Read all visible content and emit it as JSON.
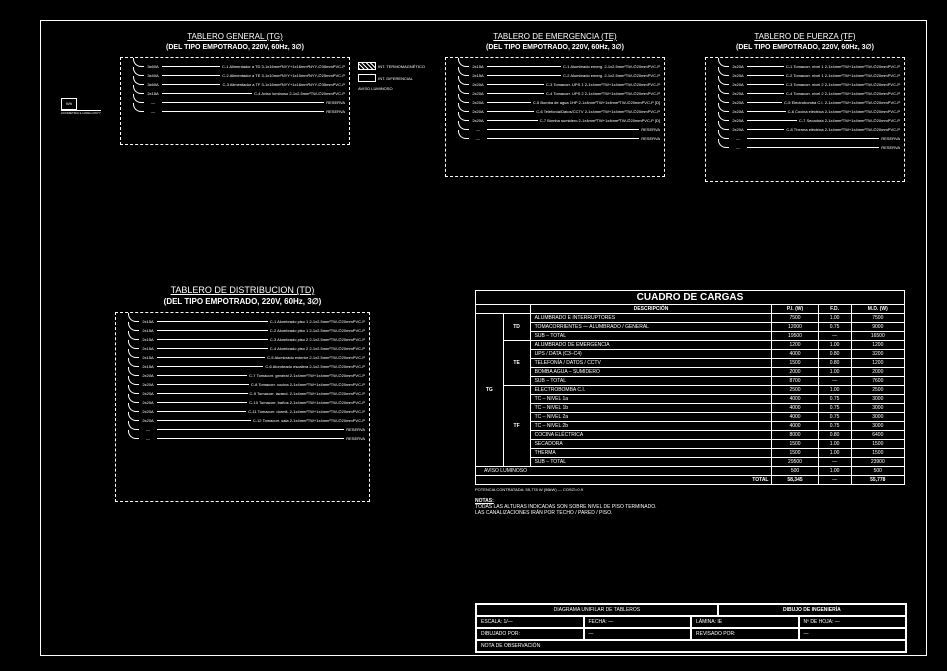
{
  "panels": {
    "tg": {
      "title": "TABLERO GENERAL (TG)",
      "sub": "(DEL TIPO EMPOTRADO, 220V, 60Hz, 3∅)",
      "circuits": [
        {
          "brk": "3x60A",
          "desc": "C-1 Alimentador a TD 3-1x16mm²NYY+1x16mm²NYY-∅35mmPVC-P"
        },
        {
          "brk": "3x40A",
          "desc": "C-2 Alimentador a TE 3-1x10mm²NYY+1x10mm²NYY-∅25mmPVC-P"
        },
        {
          "brk": "3x60A",
          "desc": "C-3 Alimentador a TF 3-1x16mm²NYY+1x16mm²NYY-∅35mmPVC-P"
        },
        {
          "brk": "2x15A",
          "desc": "C-4 Aviso luminoso 2-1x2.5mm²TW-∅20mmPVC-P"
        },
        {
          "brk": "—",
          "desc": "RESERVA"
        },
        {
          "brk": "—",
          "desc": "RESERVA"
        }
      ],
      "feed": {
        "meter": "Wh",
        "label": "ACOMETIDA  3-1x50mm²NYY"
      },
      "legend": [
        {
          "label": "INT. TERMOMAGNÉTICO",
          "cls": "hatch"
        },
        {
          "label": "INT. DIFERENCIAL",
          "cls": ""
        },
        {
          "label": "AVISO LUMINOSO",
          "cls": ""
        }
      ]
    },
    "te": {
      "title": "TABLERO DE EMERGENCIA (TE)",
      "sub": "(DEL TIPO EMPOTRADO, 220V, 60Hz, 3∅)",
      "circuits": [
        {
          "brk": "2x15A",
          "desc": "C-1 Alumbrado emerg. 2-1x2.5mm²TW-∅20mmPVC-P"
        },
        {
          "brk": "2x15A",
          "desc": "C-2 Alumbrado emerg. 2-1x2.5mm²TW-∅20mmPVC-P"
        },
        {
          "brk": "2x20A",
          "desc": "C-3 Tomacorr. UPS 1  2-1x4mm²TW+1x4mm²TW-∅20mmPVC-P"
        },
        {
          "brk": "2x20A",
          "desc": "C-4 Tomacorr. UPS 2  2-1x4mm²TW+1x4mm²TW-∅20mmPVC-P"
        },
        {
          "brk": "2x20A",
          "desc": "C-5 Bomba de agua 1HP 2-1x4mm²TW+1x4mm²TW-∅20mmPVC-P [D]"
        },
        {
          "brk": "2x20A",
          "desc": "C-6 Telefonía/Datos/CCTV 2-1x4mm²TW+1x4mm²TW-∅20mmPVC-P"
        },
        {
          "brk": "2x20A",
          "desc": "C-7 Bomba sumidero 2-1x4mm²TW+1x4mm²TW-∅20mmPVC-P [D]"
        },
        {
          "brk": "—",
          "desc": "RESERVA"
        },
        {
          "brk": "—",
          "desc": "RESERVA"
        }
      ]
    },
    "tf": {
      "title": "TABLERO DE FUERZA (TF)",
      "sub": "(DEL TIPO EMPOTRADO, 220V, 60Hz, 3∅)",
      "circuits": [
        {
          "brk": "2x20A",
          "desc": "C-1 Tomacorr. nivel 1  2-1x4mm²TW+1x4mm²TW-∅20mmPVC-P"
        },
        {
          "brk": "2x20A",
          "desc": "C-2 Tomacorr. nivel 1  2-1x4mm²TW+1x4mm²TW-∅20mmPVC-P"
        },
        {
          "brk": "2x20A",
          "desc": "C-3 Tomacorr. nivel 2  2-1x4mm²TW+1x4mm²TW-∅20mmPVC-P"
        },
        {
          "brk": "2x20A",
          "desc": "C-4 Tomacorr. nivel 2  2-1x4mm²TW+1x4mm²TW-∅20mmPVC-P"
        },
        {
          "brk": "2x20A",
          "desc": "C-5 Electrobomba C.I.  2-1x4mm²TW+1x4mm²TW-∅20mmPVC-P"
        },
        {
          "brk": "2x20A",
          "desc": "C-6 Cocina eléctrica   2-1x4mm²TW+1x4mm²TW-∅20mmPVC-P"
        },
        {
          "brk": "2x20A",
          "desc": "C-7 Secadora           2-1x4mm²TW+1x4mm²TW-∅20mmPVC-P"
        },
        {
          "brk": "2x20A",
          "desc": "C-8 Therma eléctrica   2-1x4mm²TW+1x4mm²TW-∅20mmPVC-P"
        },
        {
          "brk": "—",
          "desc": "RESERVA"
        },
        {
          "brk": "—",
          "desc": "RESERVA"
        }
      ]
    },
    "td": {
      "title": "TABLERO  DE  DISTRIBUCION  (TD)",
      "sub": "(DEL TIPO EMPOTRADO, 220V, 60Hz, 3∅)",
      "circuits": [
        {
          "brk": "2x15A",
          "desc": "C-1 Alumbrado piso 1  2-1x2.5mm²TW-∅20mmPVC-P"
        },
        {
          "brk": "2x15A",
          "desc": "C-2 Alumbrado piso 1  2-1x2.5mm²TW-∅20mmPVC-P"
        },
        {
          "brk": "2x15A",
          "desc": "C-3 Alumbrado piso 2  2-1x2.5mm²TW-∅20mmPVC-P"
        },
        {
          "brk": "2x15A",
          "desc": "C-4 Alumbrado piso 2  2-1x2.5mm²TW-∅20mmPVC-P"
        },
        {
          "brk": "2x15A",
          "desc": "C-5 Alumbrado exterior 2-1x2.5mm²TW-∅20mmPVC-P"
        },
        {
          "brk": "2x15A",
          "desc": "C-6 Alumbrado escalera 2-1x2.5mm²TW-∅20mmPVC-P"
        },
        {
          "brk": "2x20A",
          "desc": "C-7 Tomacorr. general  2-1x4mm²TW+1x4mm²TW-∅20mmPVC-P"
        },
        {
          "brk": "2x20A",
          "desc": "C-8 Tomacorr. cocina   2-1x4mm²TW+1x4mm²TW-∅20mmPVC-P"
        },
        {
          "brk": "2x20A",
          "desc": "C-9 Tomacorr. lavand.  2-1x4mm²TW+1x4mm²TW-∅20mmPVC-P"
        },
        {
          "brk": "2x20A",
          "desc": "C-10 Tomacorr. baños   2-1x4mm²TW+1x4mm²TW-∅20mmPVC-P"
        },
        {
          "brk": "2x20A",
          "desc": "C-11 Tomacorr. dormit. 2-1x4mm²TW+1x4mm²TW-∅20mmPVC-P"
        },
        {
          "brk": "2x20A",
          "desc": "C-12 Tomacorr. sala    2-1x4mm²TW+1x4mm²TW-∅20mmPVC-P"
        },
        {
          "brk": "—",
          "desc": "RESERVA"
        },
        {
          "brk": "—",
          "desc": "RESERVA"
        }
      ]
    }
  },
  "load_table": {
    "title": "CUADRO DE CARGAS",
    "headers": [
      "DESCRIPCIÓN",
      "P.I. (W)",
      "F.D.",
      "M.D. (W)"
    ],
    "groups": [
      {
        "name": "TD",
        "rows": [
          {
            "d": "ALUMBRADO E INTERRUPTORES",
            "pi": "7500",
            "fd": "1.00",
            "md": "7500"
          },
          {
            "d": "TOMACORRIENTES — ALUMBRADO / GENERAL",
            "pi": "12000",
            "fd": "0.75",
            "md": "9000"
          },
          {
            "d": "SUB – TOTAL",
            "pi": "19500",
            "fd": "",
            "md": "16500"
          }
        ]
      },
      {
        "name": "TE",
        "rows": [
          {
            "d": "ALUMBRADO DE EMERGENCIA",
            "pi": "1200",
            "fd": "1.00",
            "md": "1200"
          },
          {
            "d": "UPS / DATA (C3–C4)",
            "pi": "4000",
            "fd": "0.80",
            "md": "3200"
          },
          {
            "d": "TELEFONÍA / DATOS / CCTV",
            "pi": "1500",
            "fd": "0.80",
            "md": "1200"
          },
          {
            "d": "BOMBA AGUA – SUMIDERO",
            "pi": "2000",
            "fd": "1.00",
            "md": "2000"
          },
          {
            "d": "SUB – TOTAL",
            "pi": "8700",
            "fd": "",
            "md": "7600"
          }
        ]
      },
      {
        "name": "TF",
        "rows": [
          {
            "d": "ELECTROBOMBA C.I.",
            "pi": "2500",
            "fd": "1.00",
            "md": "2500"
          },
          {
            "d": "TC – NIVEL 1a",
            "pi": "4000",
            "fd": "0.75",
            "md": "3000"
          },
          {
            "d": "TC – NIVEL 1b",
            "pi": "4000",
            "fd": "0.75",
            "md": "3000"
          },
          {
            "d": "TC – NIVEL 2a",
            "pi": "4000",
            "fd": "0.75",
            "md": "3000"
          },
          {
            "d": "TC – NIVEL 2b",
            "pi": "4000",
            "fd": "0.75",
            "md": "3000"
          },
          {
            "d": "COCINA ELÉCTRICA",
            "pi": "8000",
            "fd": "0.80",
            "md": "6400"
          },
          {
            "d": "SECADORA",
            "pi": "1500",
            "fd": "1.00",
            "md": "1500"
          },
          {
            "d": "THERMA",
            "pi": "1500",
            "fd": "1.00",
            "md": "1500"
          },
          {
            "d": "SUB – TOTAL",
            "pi": "29500",
            "fd": "",
            "md": "23900"
          }
        ]
      }
    ],
    "aviso": {
      "d": "AVISO LUMINOSO",
      "pi": "500",
      "fd": "1.00",
      "md": "500"
    },
    "total_label": "TOTAL",
    "total_pi": "58,345",
    "total_md": "55,778",
    "footer": "POTENCIA CONTRATADA: 55,778 W (56kW) — COS∅=0.9",
    "notes_h": "NOTAS:",
    "notes": [
      "TODAS LAS ALTURAS INDICADAS SON SOBRE NIVEL DE PISO TERMINADO.",
      "LAS CANALIZACIONES IRÁN POR TECHO / PARED / PISO."
    ]
  },
  "title_block": {
    "row1_left": "DIAGRAMA UNIFILAR DE TABLEROS",
    "row1_right": "DIBUJO DE INGENIERÍA",
    "cells": [
      [
        "ESCALA: 1/—",
        "FECHA: —",
        "LÁMINA: IE",
        "Nº DE HOJA: —"
      ],
      [
        "DIBUJADO POR:",
        "—",
        "REVISADO POR:",
        "—"
      ]
    ],
    "footer": "NOTA DE OBSERVACIÓN"
  }
}
